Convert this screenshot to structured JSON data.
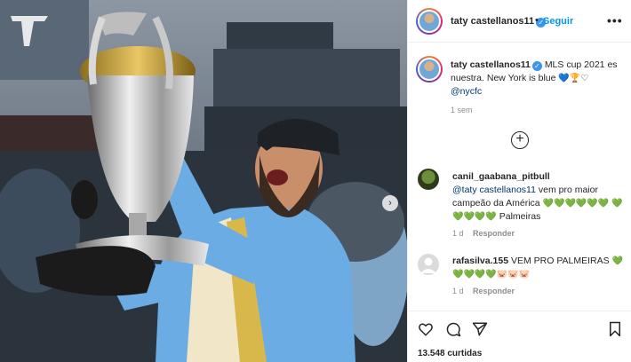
{
  "post": {
    "username": "taty castellanos11",
    "follow_label": "Seguir",
    "more_label": "•••"
  },
  "caption": {
    "username": "taty castellanos11",
    "text": "MLS cup 2021 es nuestra. New York is blue ",
    "emojis": "💙🏆♡",
    "mention": "@nycfc",
    "time": "1 sem"
  },
  "comments": [
    {
      "username": "canil_gaabana_pitbull",
      "mention": "@taty castellanos11",
      "text": " vem pro maior campeão da América ",
      "hearts1": "💚💚💚💚💚💚",
      "hearts2": "💚💚💚💚💚",
      "tail": " Palmeiras",
      "time": "1 d",
      "reply_label": "Responder"
    },
    {
      "username": "rafasilva.155",
      "text": " VEM PRO PALMEIRAS ",
      "hearts1": "💚",
      "hearts2": "💚💚💚💚",
      "pigs": "🐷🐷🐷",
      "time": "1 d",
      "reply_label": "Responder"
    }
  ],
  "actions": {
    "likes": "13.548 curtidas"
  },
  "colors": {
    "link": "#0095f6",
    "mention": "#00376b",
    "muted": "#8e8e8e",
    "sky_blue": "#6cace4"
  }
}
